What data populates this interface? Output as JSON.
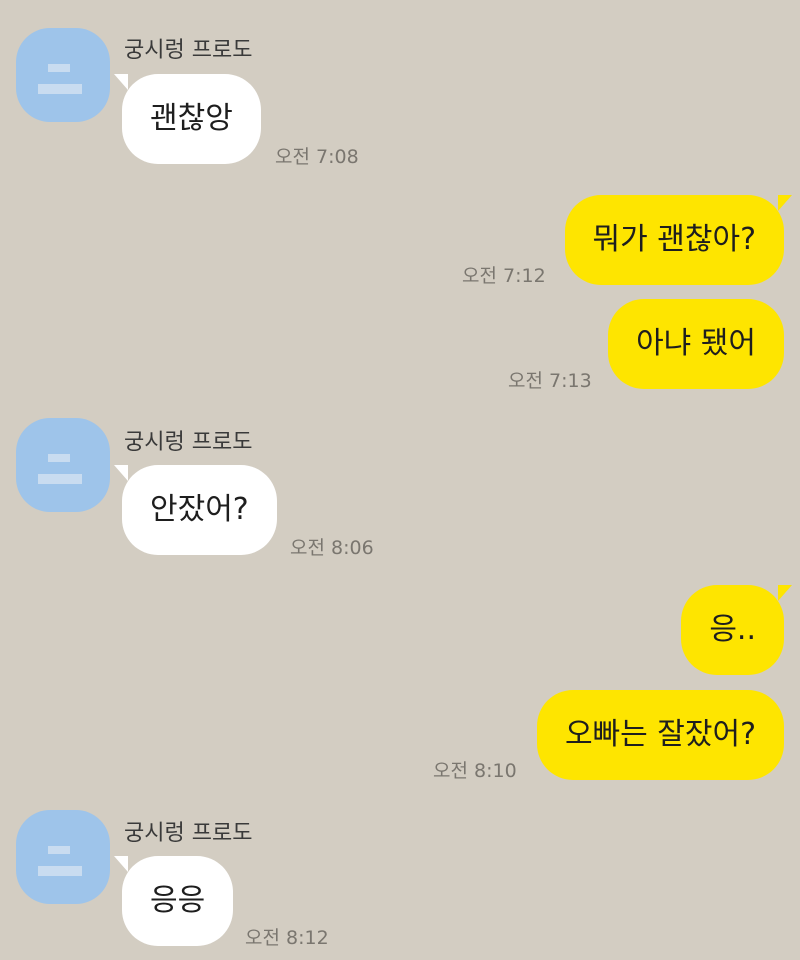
{
  "chat": {
    "messages": [
      {
        "sender": "궁시렁 프로도",
        "text": "괜찮앙",
        "time": "오전 7:08"
      },
      {
        "text": "뭐가 괜찮아?",
        "time": "오전 7:12"
      },
      {
        "text": "아냐 됐어",
        "time": "오전 7:13"
      },
      {
        "sender": "궁시렁 프로도",
        "text": "안잤어?",
        "time": "오전 8:06"
      },
      {
        "text": "응.."
      },
      {
        "text": "오빠는 잘잤어?",
        "time": "오전 8:10"
      },
      {
        "sender": "궁시렁 프로도",
        "text": "응응",
        "time": "오전 8:12"
      }
    ]
  },
  "colors": {
    "background": "#d3cdc2",
    "incoming_bubble": "#ffffff",
    "outgoing_bubble": "#fee500",
    "avatar": "#9ec4ea"
  }
}
